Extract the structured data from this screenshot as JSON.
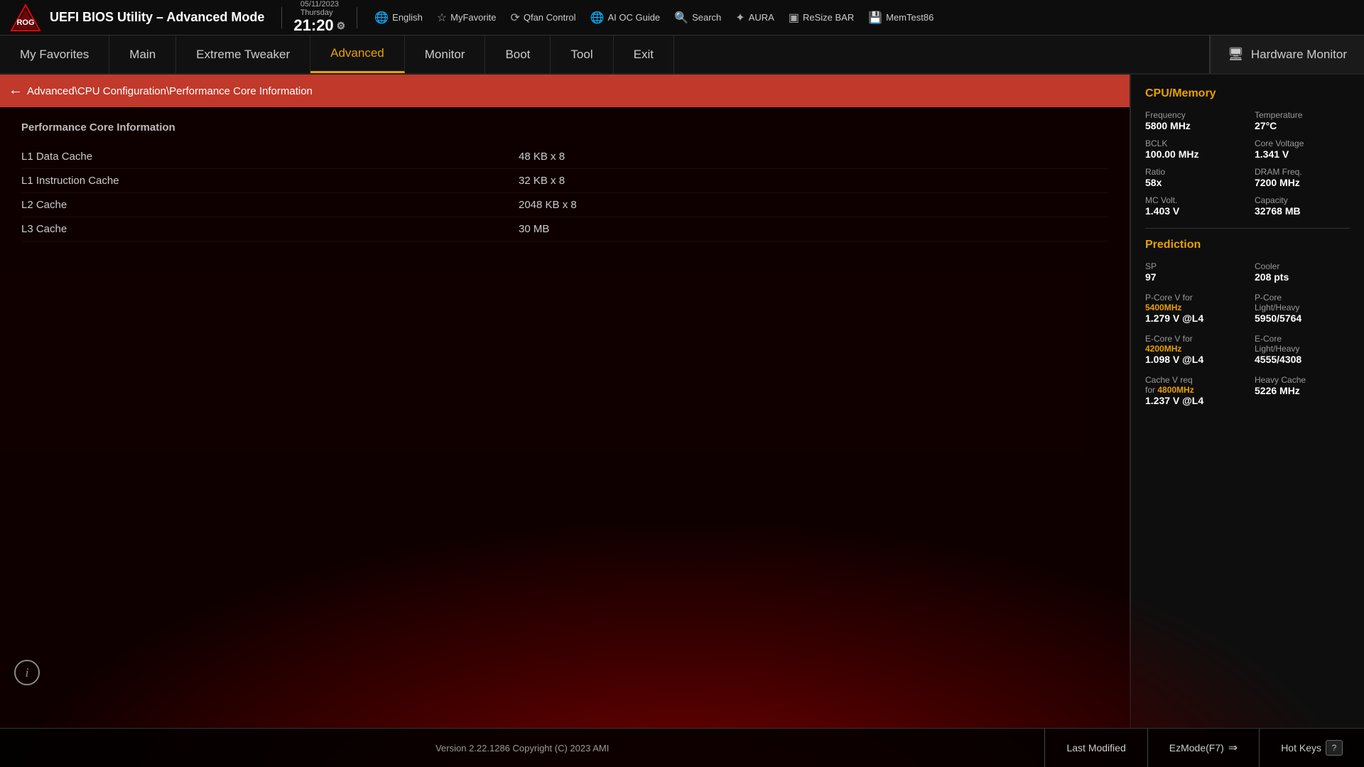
{
  "header": {
    "title": "UEFI BIOS Utility – Advanced Mode",
    "date": "05/11/2023",
    "day": "Thursday",
    "time": "21:20",
    "tools": [
      {
        "icon": "🌐",
        "label": "English"
      },
      {
        "icon": "⭐",
        "label": "MyFavorite"
      },
      {
        "icon": "🔄",
        "label": "Qfan Control"
      },
      {
        "icon": "🌐",
        "label": "AI OC Guide"
      },
      {
        "icon": "🔍",
        "label": "Search"
      },
      {
        "icon": "✨",
        "label": "AURA"
      },
      {
        "icon": "📊",
        "label": "ReSize BAR"
      },
      {
        "icon": "💾",
        "label": "MemTest86"
      }
    ]
  },
  "nav": {
    "tabs": [
      {
        "label": "My Favorites",
        "active": false
      },
      {
        "label": "Main",
        "active": false
      },
      {
        "label": "Extreme Tweaker",
        "active": false
      },
      {
        "label": "Advanced",
        "active": true
      },
      {
        "label": "Monitor",
        "active": false
      },
      {
        "label": "Boot",
        "active": false
      },
      {
        "label": "Tool",
        "active": false
      },
      {
        "label": "Exit",
        "active": false
      }
    ],
    "hardware_monitor_label": "Hardware Monitor"
  },
  "breadcrumb": {
    "path": "Advanced\\CPU Configuration\\Performance Core Information"
  },
  "content": {
    "section_title": "Performance Core Information",
    "rows": [
      {
        "label": "L1 Data Cache",
        "value": "48 KB x 8"
      },
      {
        "label": "L1 Instruction Cache",
        "value": "32 KB x 8"
      },
      {
        "label": "L2 Cache",
        "value": "2048 KB x 8"
      },
      {
        "label": "L3 Cache",
        "value": "30 MB"
      }
    ]
  },
  "hardware_monitor": {
    "title": "Hardware Monitor",
    "cpu_memory_title": "CPU/Memory",
    "items": [
      {
        "label": "Frequency",
        "value": "5800 MHz"
      },
      {
        "label": "Temperature",
        "value": "27°C"
      },
      {
        "label": "BCLK",
        "value": "100.00 MHz"
      },
      {
        "label": "Core Voltage",
        "value": "1.341 V"
      },
      {
        "label": "Ratio",
        "value": "58x"
      },
      {
        "label": "DRAM Freq.",
        "value": "7200 MHz"
      },
      {
        "label": "MC Volt.",
        "value": "1.403 V"
      },
      {
        "label": "Capacity",
        "value": "32768 MB"
      }
    ],
    "prediction_title": "Prediction",
    "prediction": {
      "sp_label": "SP",
      "sp_value": "97",
      "cooler_label": "Cooler",
      "cooler_value": "208 pts",
      "pcore_v_label": "P-Core V for",
      "pcore_v_freq": "5400MHz",
      "pcore_v_value": "1.279 V @L4",
      "pcore_lh_label": "P-Core Light/Heavy",
      "pcore_lh_value": "5950/5764",
      "ecore_v_label": "E-Core V for",
      "ecore_v_freq": "4200MHz",
      "ecore_v_value": "1.098 V @L4",
      "ecore_lh_label": "E-Core Light/Heavy",
      "ecore_lh_value": "4555/4308",
      "cache_v_label": "Cache V req for",
      "cache_v_freq": "4800MHz",
      "cache_v_value": "1.237 V @L4",
      "heavy_cache_label": "Heavy Cache",
      "heavy_cache_value": "5226 MHz"
    }
  },
  "footer": {
    "version": "Version 2.22.1286 Copyright (C) 2023 AMI",
    "last_modified": "Last Modified",
    "ez_mode": "EzMode(F7)",
    "hot_keys": "Hot Keys"
  }
}
